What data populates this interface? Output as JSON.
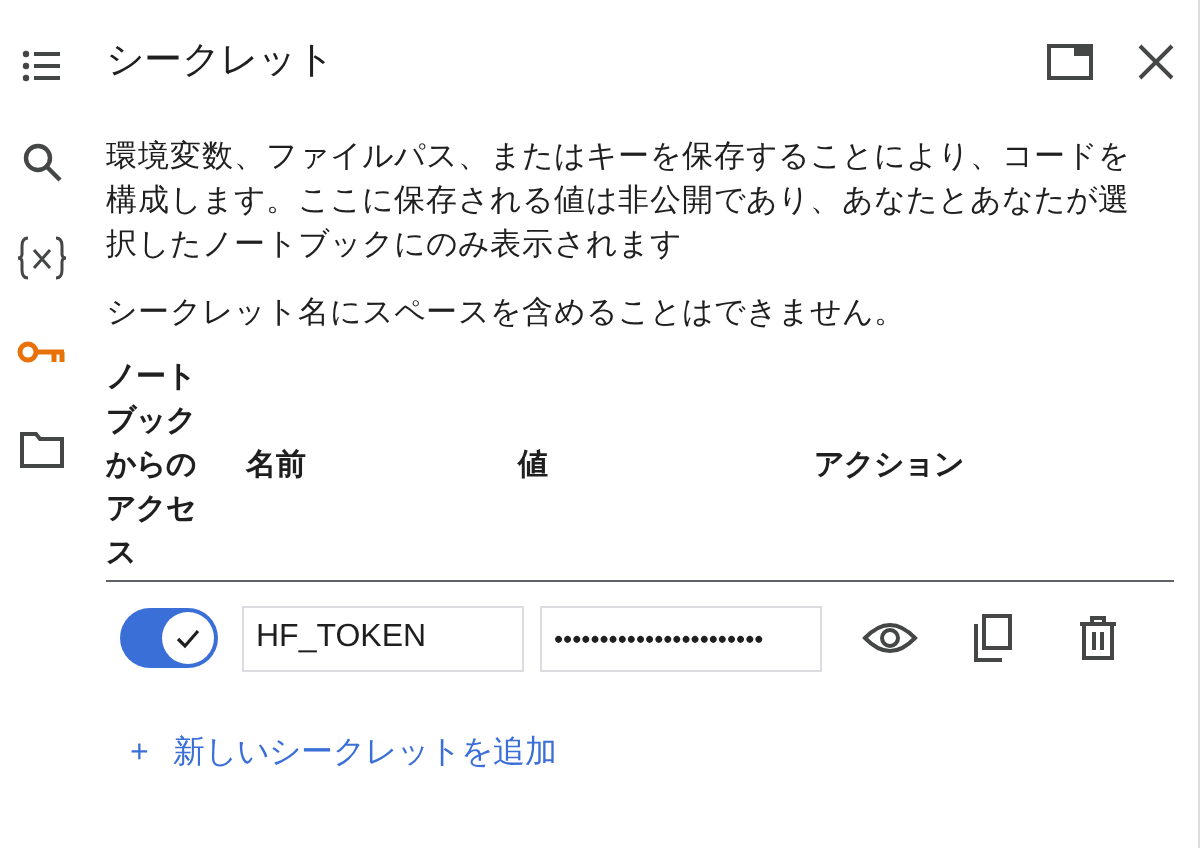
{
  "sidebar": {
    "items": [
      {
        "kind": "toc",
        "selected": false
      },
      {
        "kind": "search",
        "selected": false
      },
      {
        "kind": "variables",
        "selected": false
      },
      {
        "kind": "key",
        "selected": true
      },
      {
        "kind": "folder",
        "selected": false
      }
    ]
  },
  "panel": {
    "title": "シークレット",
    "description": "環境変数、ファイルパス、またはキーを保存することにより、コードを構成します。ここに保存される値は非公開であり、あなたとあなたが選択したノートブックにのみ表示されます",
    "note": "シークレット名にスペースを含めることはできません。"
  },
  "table": {
    "columns": [
      "ノートブックからのアクセス",
      "名前",
      "値",
      "アクション"
    ],
    "rows": [
      {
        "access": true,
        "name": "HF_TOKEN",
        "value": "•••••••••••••••••••••••"
      }
    ]
  },
  "add_button": {
    "icon": "+",
    "label": "新しいシークレットを追加"
  }
}
